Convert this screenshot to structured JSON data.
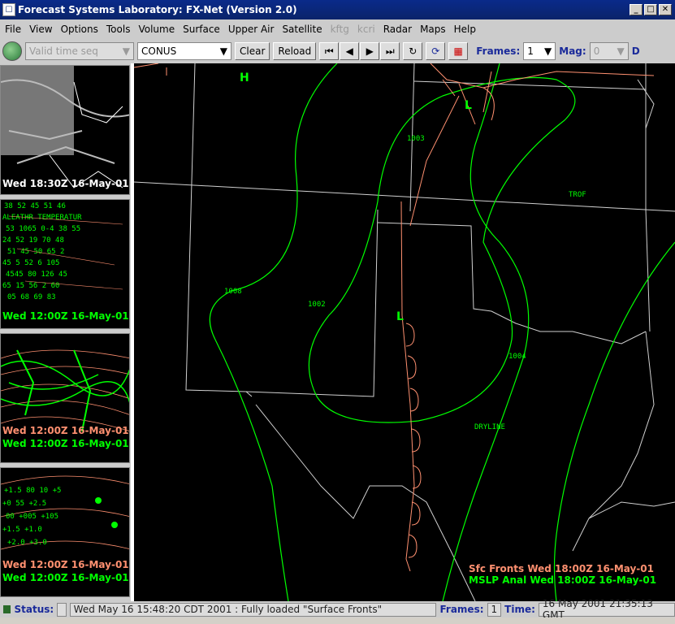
{
  "window": {
    "title": "Forecast Systems Laboratory:  FX-Net (Version 2.0)",
    "icon": "fx-app-icon",
    "buttons": [
      "_",
      "□",
      "✕"
    ]
  },
  "menu": [
    "File",
    "View",
    "Options",
    "Tools",
    "Volume",
    "Surface",
    "Upper Air",
    "Satellite",
    "kftg",
    "kcri",
    "Radar",
    "Maps",
    "Help"
  ],
  "menu_disabled": [
    "kftg",
    "kcri"
  ],
  "toolbar": {
    "time_seq": "Valid time seq",
    "region": "CONUS",
    "clear": "Clear",
    "reload": "Reload",
    "nav": [
      "⏮",
      "◀",
      "▶",
      "⏭"
    ],
    "loop_icon": "↻",
    "frames_label": "Frames:",
    "frames_value": "1",
    "mag_label": "Mag:",
    "mag_value": "0",
    "extra": "D"
  },
  "thumbnails": [
    {
      "kind": "satellite",
      "label": "Wed 18:30Z 16-May-01",
      "label_color": "#ffffff"
    },
    {
      "kind": "surface-obs",
      "label": "Wed 12:00Z 16-May-01",
      "label_color": "#00ff00"
    },
    {
      "kind": "contours",
      "label1": "Wed 12:00Z 16-May-01",
      "label2": "Wed 12:00Z 16-May-01",
      "c1": "#ff9070",
      "c2": "#00ff00"
    },
    {
      "kind": "upper-air",
      "label1": "Wed 12:00Z 16-May-01",
      "label2": "Wed 12:00Z 16-May-01",
      "c1": "#ff9070",
      "c2": "#00ff00"
    }
  ],
  "map": {
    "highs": [
      "H"
    ],
    "lows": [
      "L",
      "L"
    ],
    "isobars": [
      "1003",
      "1008",
      "1002",
      "1004"
    ],
    "features": [
      "TROF",
      "DRYLINE"
    ],
    "legend1": "Sfc Fronts Wed 18:00Z 16-May-01",
    "legend2": "MSLP Anal Wed 18:00Z 16-May-01",
    "colors": {
      "front": "#ff9070",
      "isobar": "#00ff00",
      "border": "#d0d0d0"
    }
  },
  "status": {
    "label": "Status:",
    "message": "Wed May 16 15:48:20 CDT 2001 :  Fully loaded \"Surface Fronts\"",
    "frames_label": "Frames:",
    "frames_value": "1",
    "time_label": "Time:",
    "time_value": "16 May 2001 21:35:13 GMT"
  }
}
